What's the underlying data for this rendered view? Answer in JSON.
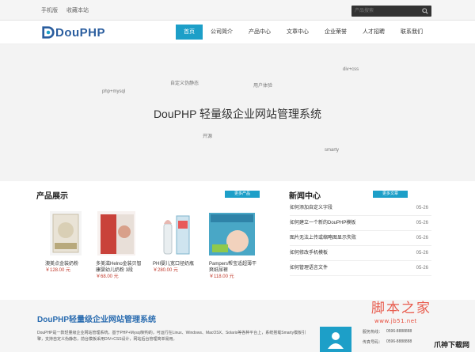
{
  "topbar": {
    "links": [
      "手机版",
      "收藏本站"
    ],
    "search_placeholder": "产品搜索"
  },
  "header": {
    "logo_text": "DouPHP",
    "nav": [
      "首页",
      "公司简介",
      "产品中心",
      "文章中心",
      "企业荣誉",
      "人才招聘",
      "联系我们"
    ],
    "active_index": 0
  },
  "hero": {
    "title": "DouPHP 轻量级企业网站管理系统",
    "words": [
      "div+css",
      "自定义伪静态",
      "用户体验",
      "php+mysql",
      "开源",
      "smarty"
    ]
  },
  "products": {
    "title": "产品展示",
    "more_label": "更多产品",
    "items": [
      {
        "name": "澳美点金装奶粉",
        "price": "￥128.00 元"
      },
      {
        "name": "多美滋Helno金装贝智康婴幼儿奶粉 3段",
        "price": "￥68.00 元"
      },
      {
        "name": "PHI婴儿宽口径奶瓶",
        "price": "￥280.00 元"
      },
      {
        "name": "Pampers帮宝适超薄干爽纸尿裤",
        "price": "￥118.00 元"
      }
    ]
  },
  "news": {
    "title": "新闻中心",
    "more_label": "更多文章",
    "items": [
      {
        "title": "如何添加自定义字段",
        "date": "05-26"
      },
      {
        "title": "如何建立一个新的DouPHP模板",
        "date": "05-26"
      },
      {
        "title": "图片无法上传或缩略图显示失败",
        "date": "05-26"
      },
      {
        "title": "如何修改手机模板",
        "date": "05-26"
      },
      {
        "title": "如何管理语言文件",
        "date": "05-26"
      }
    ]
  },
  "about": {
    "title": "DouPHP轻量级企业网站管理系统",
    "text": "DouPHP是一款轻量级企业网站管理系统，基于PHP+Mysql架构的，可运行在Linux、Windows、MacOSX、Solaris等各种平台上，系统搭载Smarty模板引擎，支持自定义伪静态，前台模板采用DIV+CSS设计，网站后台管理简单易用。",
    "phone_label": "服务热线：",
    "phone": "0596-8888888",
    "fax_label": "传真号码：",
    "fax": "0596-8888888"
  },
  "watermark": {
    "main": "脚本之家",
    "url": "www.jb51.net",
    "corner": "爪神下载网"
  },
  "colors": {
    "accent": "#1d9fc8",
    "logo": "#2a5d9e",
    "price": "#c0392b"
  }
}
